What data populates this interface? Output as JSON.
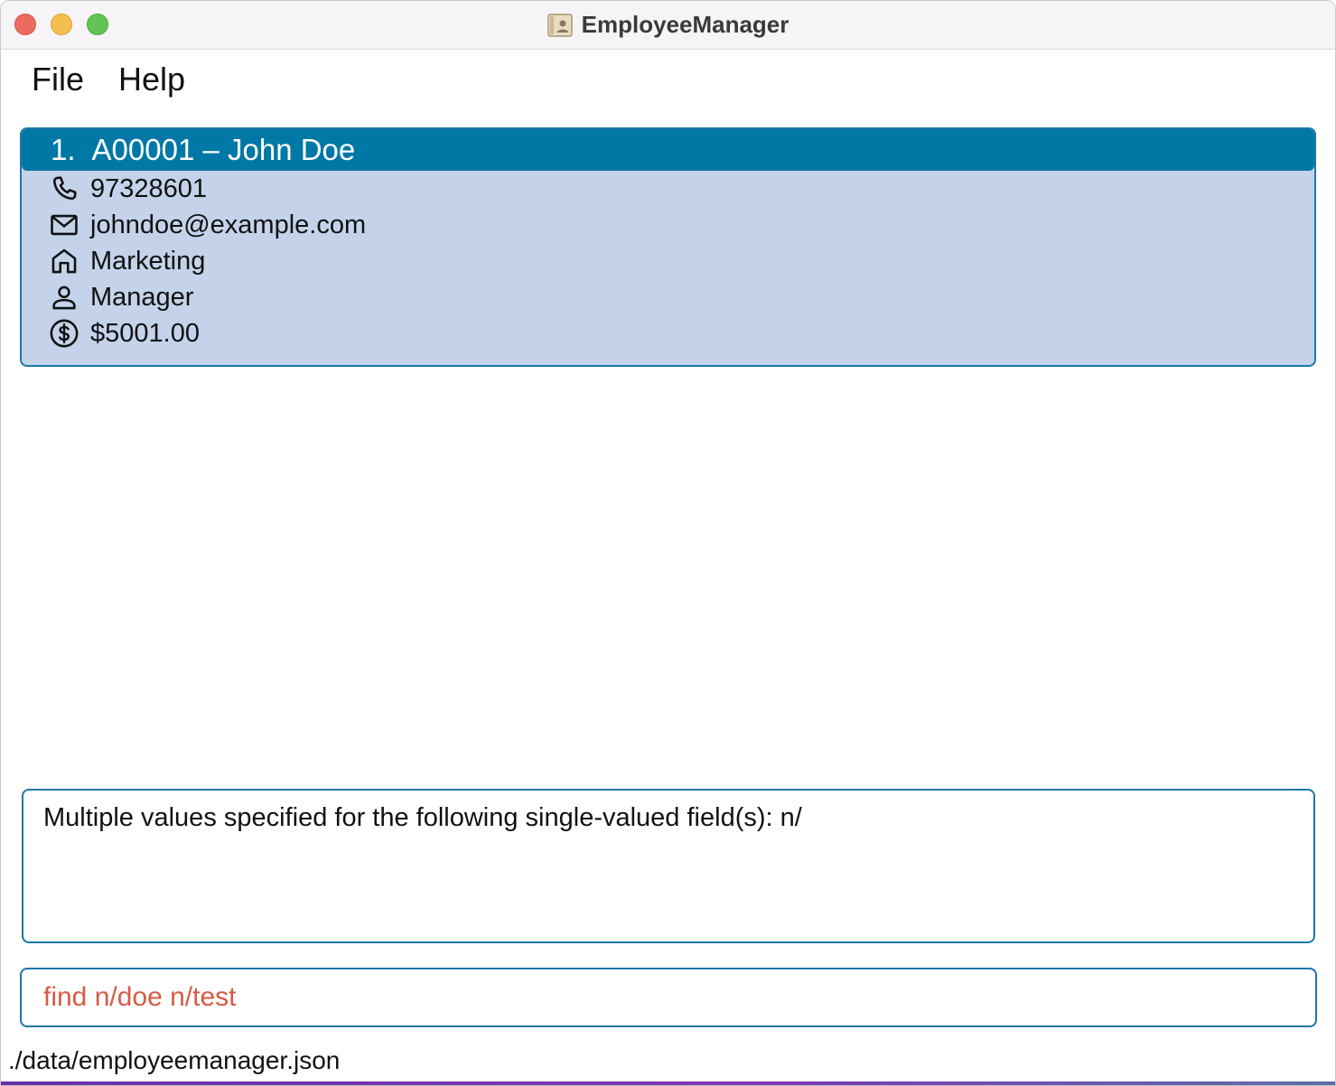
{
  "window": {
    "title": "EmployeeManager",
    "app_icon": "contact-card-icon"
  },
  "menu": {
    "items": [
      {
        "label": "File"
      },
      {
        "label": "Help"
      }
    ]
  },
  "employees": [
    {
      "index": "1.",
      "id_name": "A00001 – John Doe",
      "phone": "97328601",
      "email": "johndoe@example.com",
      "department": "Marketing",
      "role": "Manager",
      "salary": "$5001.00"
    }
  ],
  "result": {
    "message": "Multiple values specified for the following single-valued field(s): n/"
  },
  "command": {
    "value": "find n/doe n/test"
  },
  "status": {
    "file_path": "./data/employeemanager.json"
  },
  "colors": {
    "accent": "#0078a6",
    "card_bg": "#c4d3ea",
    "border": "#1b78a8",
    "error_text": "#d55b45"
  }
}
